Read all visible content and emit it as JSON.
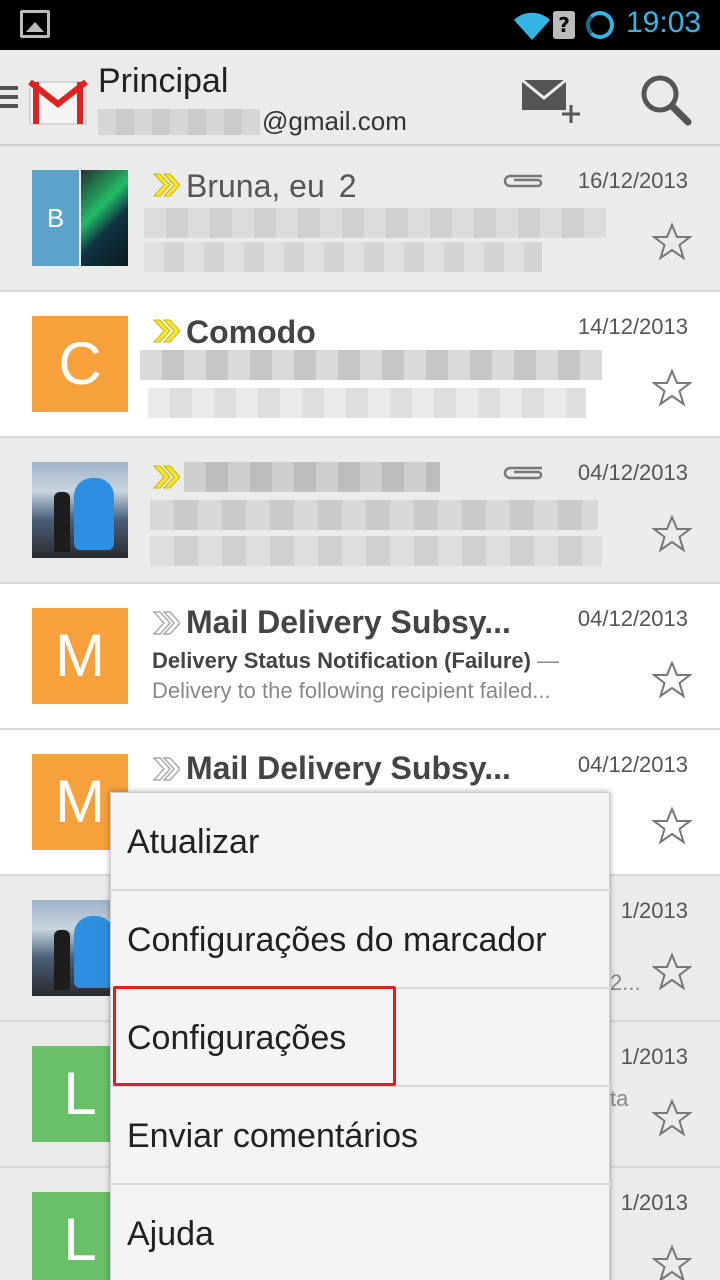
{
  "status_bar": {
    "time": "19:03"
  },
  "header": {
    "title": "Principal",
    "account_suffix": "@gmail.com",
    "compose_icon": "compose-mail-icon",
    "search_icon": "search-icon"
  },
  "emails": [
    {
      "sender": "Bruna, eu",
      "count": "2",
      "date": "16/12/2013",
      "avatar_letter": "B",
      "has_attachment": true,
      "read": true
    },
    {
      "sender": "Comodo",
      "date": "14/12/2013",
      "avatar_letter": "C",
      "avatar_color": "#f7a13c",
      "read": false
    },
    {
      "date": "04/12/2013",
      "has_attachment": true,
      "read": true
    },
    {
      "sender": "Mail Delivery Subsy...",
      "date": "04/12/2013",
      "avatar_letter": "M",
      "avatar_color": "#f7a13c",
      "subject": "Delivery Status Notification (Failure)",
      "subject_sep": " —",
      "snippet": "Delivery to the following recipient failed...",
      "read": false
    },
    {
      "sender": "Mail Delivery Subsy...",
      "date": "04/12/2013",
      "avatar_letter": "M",
      "avatar_color": "#f7a13c",
      "read": false
    },
    {
      "date_partial": "1/2013",
      "snippet_partial": "2...",
      "read": true
    },
    {
      "date_partial": "1/2013",
      "snippet_partial": "ta",
      "avatar_letter": "L",
      "avatar_color": "#6abf69",
      "read": true
    },
    {
      "date_partial": "1/2013",
      "avatar_letter": "L",
      "avatar_color": "#6abf69",
      "read": true
    }
  ],
  "menu": {
    "items": [
      "Atualizar",
      "Configurações do marcador",
      "Configurações",
      "Enviar comentários",
      "Ajuda"
    ],
    "highlighted": "Configurações"
  },
  "colors": {
    "accent": "#33b5e5",
    "highlight_border": "#e02020",
    "orange_avatar": "#f7a13c",
    "green_avatar": "#6abf69",
    "importance_marker": "#f5e33a"
  }
}
